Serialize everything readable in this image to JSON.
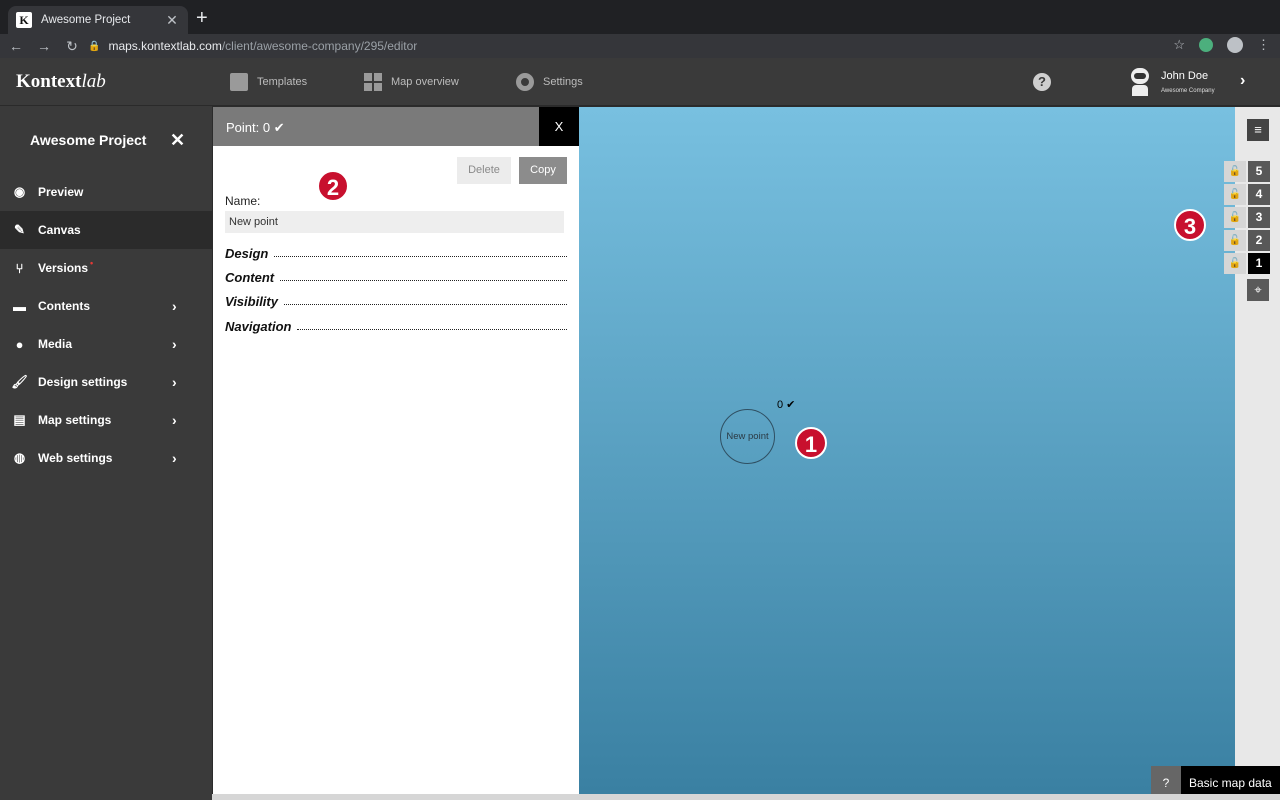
{
  "browser": {
    "tab_title": "Awesome Project",
    "favicon_letter": "K",
    "url_host": "maps.kontextlab.com",
    "url_path": "/client/awesome-company/295/editor"
  },
  "header": {
    "logo_main": "Kontext",
    "logo_italic": "lab",
    "nav": [
      {
        "label": "Templates",
        "icon": "templates-icon"
      },
      {
        "label": "Map overview",
        "icon": "grid-icon"
      },
      {
        "label": "Settings",
        "icon": "gear-icon"
      }
    ],
    "help_symbol": "?",
    "user": {
      "name": "John Doe",
      "company": "Awesome Company"
    }
  },
  "sidebar": {
    "project_title": "Awesome Project",
    "items": [
      {
        "label": "Preview",
        "icon": "eye-icon",
        "active": false,
        "chevron": false
      },
      {
        "label": "Canvas",
        "icon": "edit-icon",
        "active": true,
        "chevron": false
      },
      {
        "label": "Versions",
        "icon": "branch-icon",
        "active": false,
        "chevron": false,
        "dot": "•"
      },
      {
        "label": "Contents",
        "icon": "folder-icon",
        "active": false,
        "chevron": true
      },
      {
        "label": "Media",
        "icon": "media-icon",
        "active": false,
        "chevron": true
      },
      {
        "label": "Design settings",
        "icon": "brush-icon",
        "active": false,
        "chevron": true
      },
      {
        "label": "Map settings",
        "icon": "map-icon",
        "active": false,
        "chevron": true
      },
      {
        "label": "Web settings",
        "icon": "globe-icon",
        "active": false,
        "chevron": true
      }
    ]
  },
  "panel": {
    "title": "Point: 0 ✔",
    "close_label": "X",
    "delete_label": "Delete",
    "copy_label": "Copy",
    "name_label": "Name:",
    "name_value": "New point",
    "sections": [
      "Design",
      "Content",
      "Visibility",
      "Navigation"
    ]
  },
  "map": {
    "point_label": "New point",
    "point_id_label": "0 ✔",
    "layers": [
      "5",
      "4",
      "3",
      "2",
      "1"
    ],
    "active_layer": "1",
    "basic_map_help": "?",
    "basic_map_label": "Basic map data"
  },
  "badges": {
    "one": "1",
    "two": "2",
    "three": "3"
  },
  "colors": {
    "badge": "#c8102e",
    "map_top": "#78c0e0",
    "map_bottom": "#3a80a2",
    "sidebar": "#3a3a3a"
  }
}
